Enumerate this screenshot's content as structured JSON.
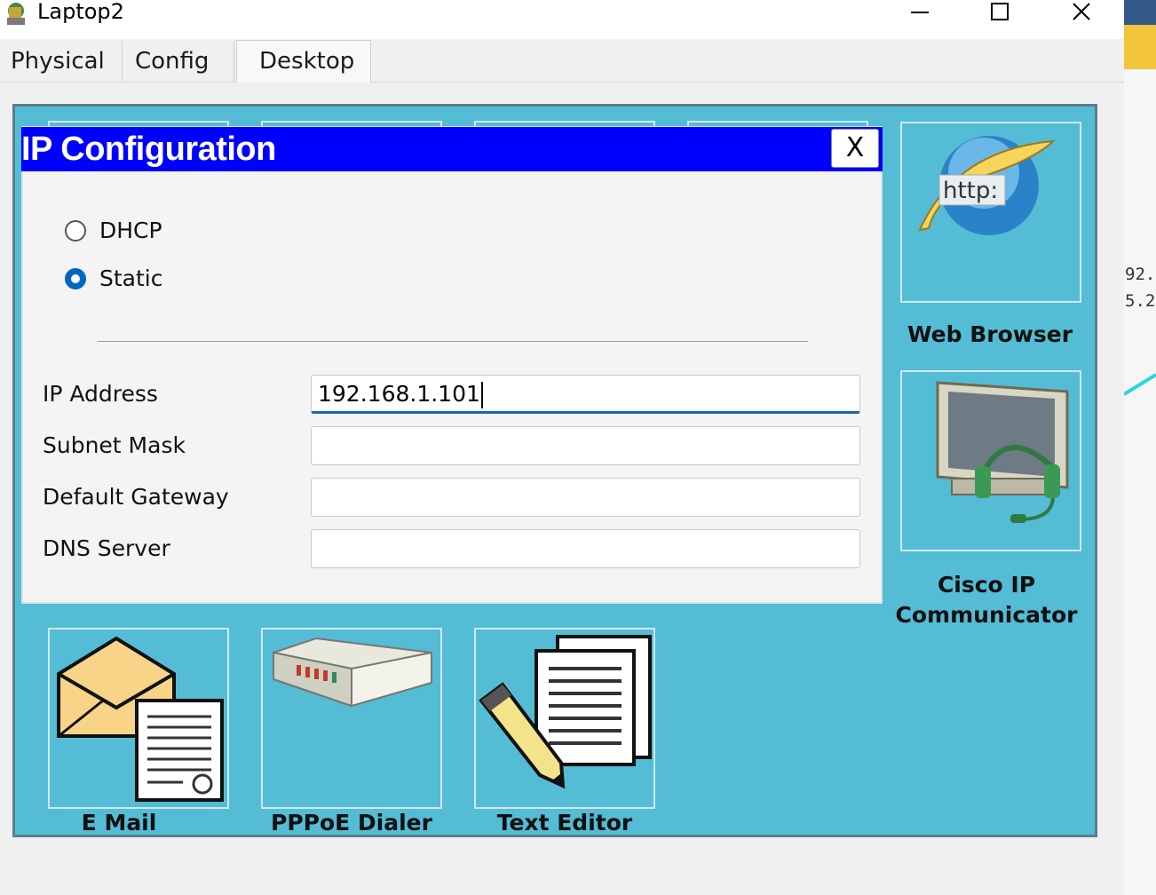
{
  "window": {
    "title": "Laptop2",
    "icon": "laptop-app-icon"
  },
  "tabs": [
    {
      "label": "Physical"
    },
    {
      "label": "Config"
    },
    {
      "label": "Desktop",
      "active": true
    }
  ],
  "dialog": {
    "title": "IP Configuration",
    "close_label": "X",
    "mode_options": [
      {
        "label": "DHCP",
        "selected": false
      },
      {
        "label": "Static",
        "selected": true
      }
    ],
    "fields": [
      {
        "label": "IP Address",
        "value": "192.168.1.101"
      },
      {
        "label": "Subnet Mask",
        "value": ""
      },
      {
        "label": "Default Gateway",
        "value": ""
      },
      {
        "label": "DNS Server",
        "value": ""
      }
    ]
  },
  "desktop_apps": [
    {
      "label": "Web Browser",
      "icon": "web-browser-icon",
      "icon_text": "http:"
    },
    {
      "label": "Cisco IP Communicator",
      "label_lines": [
        "Cisco IP",
        "Communicator"
      ],
      "icon": "ip-communicator-icon"
    },
    {
      "label": "E Mail",
      "icon": "email-icon"
    },
    {
      "label": "PPPoE Dialer",
      "icon": "pppoe-dialer-icon"
    },
    {
      "label": "Text Editor",
      "icon": "text-editor-icon"
    }
  ],
  "background_app": {
    "text_lines": [
      "92.",
      "5.2"
    ]
  },
  "colors": {
    "desktop_bg": "#54bcd5",
    "dialog_titlebar": "#0000ff",
    "radio_selected": "#0067c0"
  }
}
